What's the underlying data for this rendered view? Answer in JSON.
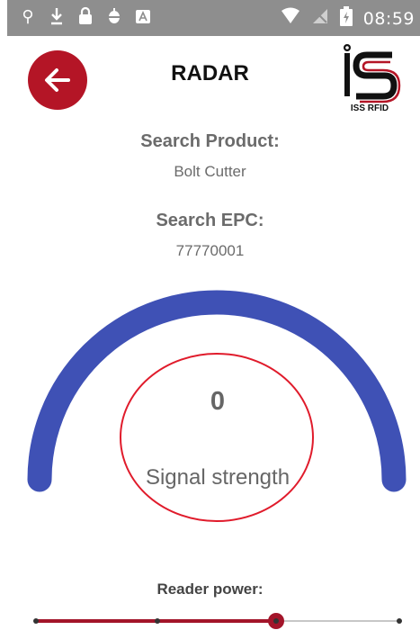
{
  "status_bar": {
    "time": "08:59",
    "left_icons": [
      "usb-icon",
      "download-icon",
      "lock-icon",
      "android-debug-icon",
      "keyboard-icon"
    ],
    "right_icons": [
      "wifi-icon",
      "no-signal-icon",
      "battery-charging-icon"
    ]
  },
  "header": {
    "title": "RADAR",
    "logo_text": "ISS RFID",
    "back_icon": "arrow-left-icon"
  },
  "search": {
    "product_label": "Search Product:",
    "product_value": "Bolt Cutter",
    "epc_label": "Search EPC:",
    "epc_value": "77770001"
  },
  "signal": {
    "value": "0",
    "label": "Signal strength"
  },
  "reader_power": {
    "label": "Reader power:",
    "level_fraction": 0.66,
    "steps": 4
  },
  "colors": {
    "accent": "#b41526",
    "gauge_arc": "#3f51b5",
    "circle": "#e01b2b",
    "status_bar": "#8e8e8e"
  }
}
